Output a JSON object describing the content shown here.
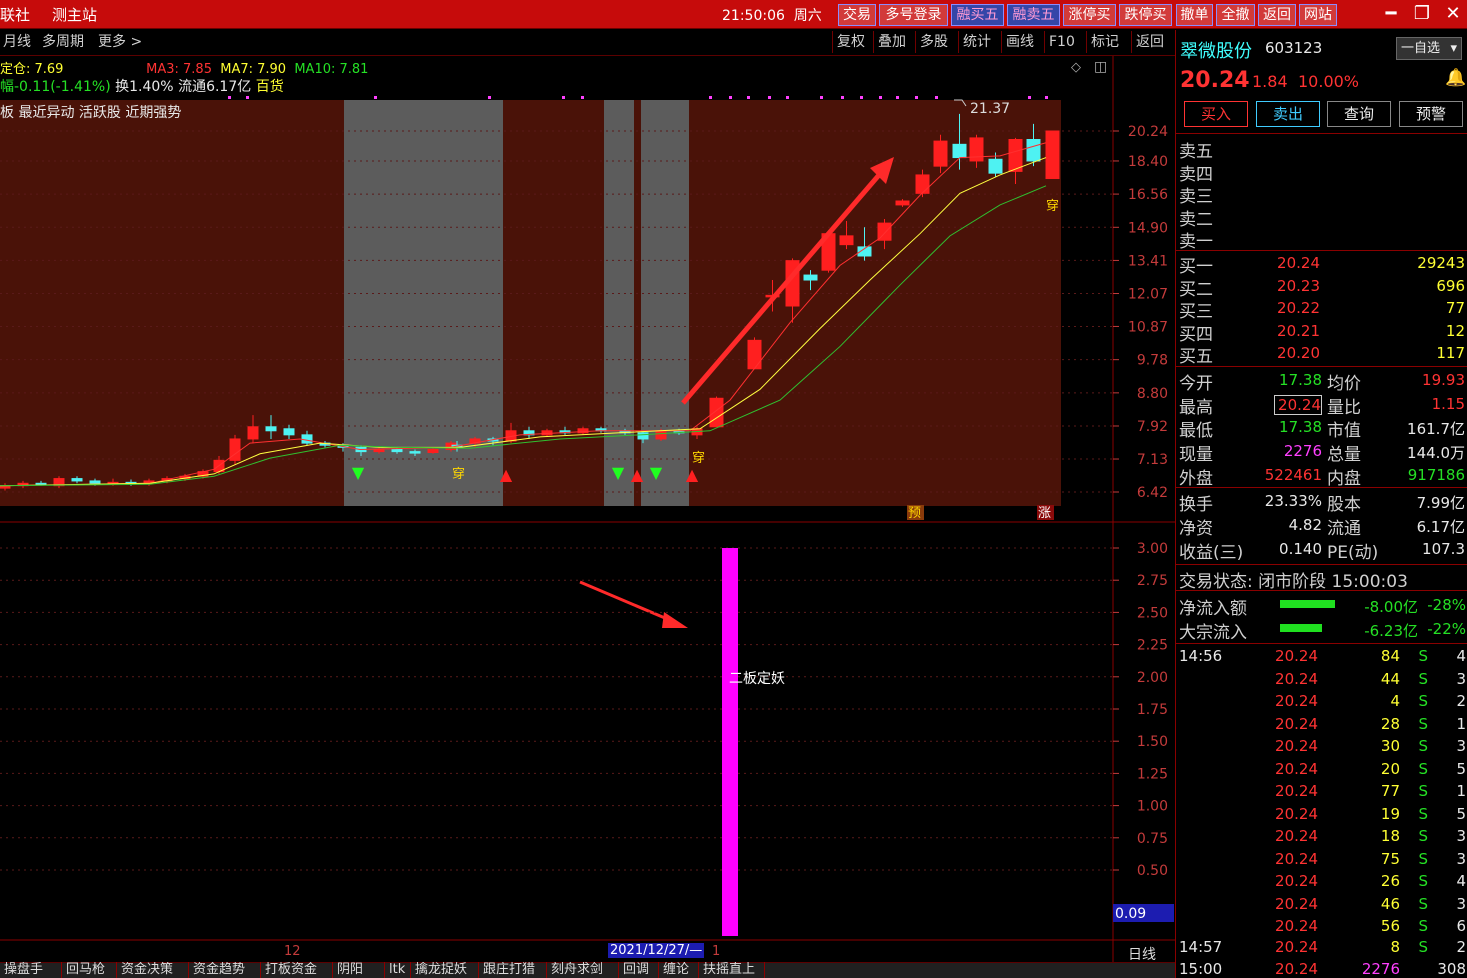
{
  "titlebar": {
    "left_items": [
      "联社",
      "测主站"
    ],
    "time": "21:50:06",
    "weekday": "周六",
    "quick_buttons": [
      "交易",
      "多号登录",
      "融买五",
      "融卖五",
      "涨停买",
      "跌停买",
      "撤单",
      "全撤",
      "返回",
      "网站"
    ],
    "win_buttons": [
      "minimize-icon",
      "restore-icon",
      "close-icon"
    ]
  },
  "toolbar": {
    "left": [
      "月线",
      "多周期",
      "更多 >"
    ],
    "right": [
      "复权",
      "叠加",
      "多股",
      "统计",
      "画线",
      "F10",
      "标记",
      "返回"
    ]
  },
  "chart": {
    "info_line1": {
      "pos": "定仓: 7.69",
      "ma3": "MA3: 7.85",
      "ma7": "MA7: 7.90",
      "ma10": "MA10: 7.81"
    },
    "info_line2": {
      "chg": "幅-0.11(-1.41%)",
      "turnover": "换1.40% 流通6.17亿",
      "sector": "百货"
    },
    "tags": "板 最近异动 活跃股 近期强势",
    "high_label": "21.37",
    "y_ticks": [
      "20.24",
      "18.40",
      "16.56",
      "14.90",
      "13.41",
      "12.07",
      "10.87",
      "9.78",
      "8.80",
      "7.92",
      "7.13",
      "6.42"
    ],
    "markers": {
      "yu": "预",
      "zhang": "涨",
      "chuan": "穿"
    },
    "colors": {
      "bg": "#4a1208",
      "gray": "#5c5c5c",
      "up": "#ff1f1f",
      "down": "#4ef2f2",
      "ma3": "#ffff40",
      "ma10": "#30c030"
    }
  },
  "indicator": {
    "y_ticks": [
      "3.00",
      "2.75",
      "2.50",
      "2.25",
      "2.00",
      "1.75",
      "1.50",
      "1.25",
      "1.00",
      "0.75",
      "0.50"
    ],
    "value": "0.09",
    "label": "二板定妖",
    "bar_color": "#ff00ff",
    "bar_value": 3.0
  },
  "xaxis": {
    "month": "12",
    "date": "2021/12/27/—",
    "next": "1",
    "period": "日线",
    "zoom": [
      "+",
      "−"
    ]
  },
  "bottom_tabs": [
    "操盘手",
    "回马枪",
    "资金决策",
    "资金趋势",
    "打板资金",
    "阴阳",
    "ltk",
    "擒龙捉妖",
    "跟庄打猎",
    "刻舟求剑",
    "回调",
    "缠论",
    "扶摇直上"
  ],
  "stock": {
    "name": "翠微股份",
    "code": "603123",
    "watch": "一自选",
    "price": "20.24",
    "change": "1.84",
    "pct": "10.00%",
    "actions": [
      "买入",
      "卖出",
      "查询",
      "预警"
    ],
    "sell_levels": [
      "卖五",
      "卖四",
      "卖三",
      "卖二",
      "卖一"
    ],
    "buy_levels": [
      {
        "label": "买一",
        "price": "20.24",
        "vol": "29243"
      },
      {
        "label": "买二",
        "price": "20.23",
        "vol": "696"
      },
      {
        "label": "买三",
        "price": "20.22",
        "vol": "77"
      },
      {
        "label": "买四",
        "price": "20.21",
        "vol": "12"
      },
      {
        "label": "买五",
        "price": "20.20",
        "vol": "117"
      }
    ],
    "stats": [
      [
        "今开",
        "17.38",
        "均价",
        "19.93"
      ],
      [
        "最高",
        "20.24",
        "量比",
        "1.15"
      ],
      [
        "最低",
        "17.38",
        "市值",
        "161.7亿"
      ],
      [
        "现量",
        "2276",
        "总量",
        "144.0万"
      ],
      [
        "外盘",
        "522461",
        "内盘",
        "917186"
      ]
    ],
    "stats2": [
      [
        "换手",
        "23.33%",
        "股本",
        "7.99亿"
      ],
      [
        "净资",
        "4.82",
        "流通",
        "6.17亿"
      ],
      [
        "收益(三)",
        "0.140",
        "PE(动)",
        "107.3"
      ]
    ],
    "trade_status": "交易状态: 闭市阶段 15:00:03",
    "flows": [
      {
        "label": "净流入额",
        "value": "-8.00亿",
        "pct": "-28%"
      },
      {
        "label": "大宗流入",
        "value": "-6.23亿",
        "pct": "-22%"
      }
    ],
    "ticks": [
      {
        "t": "14:56",
        "p": "20.24",
        "v": "84",
        "s": "S",
        "n": "4"
      },
      {
        "t": "",
        "p": "20.24",
        "v": "44",
        "s": "S",
        "n": "3"
      },
      {
        "t": "",
        "p": "20.24",
        "v": "4",
        "s": "S",
        "n": "2"
      },
      {
        "t": "",
        "p": "20.24",
        "v": "28",
        "s": "S",
        "n": "1"
      },
      {
        "t": "",
        "p": "20.24",
        "v": "30",
        "s": "S",
        "n": "3"
      },
      {
        "t": "",
        "p": "20.24",
        "v": "20",
        "s": "S",
        "n": "5"
      },
      {
        "t": "",
        "p": "20.24",
        "v": "77",
        "s": "S",
        "n": "1"
      },
      {
        "t": "",
        "p": "20.24",
        "v": "19",
        "s": "S",
        "n": "5"
      },
      {
        "t": "",
        "p": "20.24",
        "v": "18",
        "s": "S",
        "n": "3"
      },
      {
        "t": "",
        "p": "20.24",
        "v": "75",
        "s": "S",
        "n": "3"
      },
      {
        "t": "",
        "p": "20.24",
        "v": "26",
        "s": "S",
        "n": "4"
      },
      {
        "t": "",
        "p": "20.24",
        "v": "46",
        "s": "S",
        "n": "3"
      },
      {
        "t": "",
        "p": "20.24",
        "v": "56",
        "s": "S",
        "n": "6"
      },
      {
        "t": "14:57",
        "p": "20.24",
        "v": "8",
        "s": "S",
        "n": "2"
      },
      {
        "t": "15:00",
        "p": "20.24",
        "v": "2276",
        "s": "",
        "n": "308"
      }
    ]
  }
}
